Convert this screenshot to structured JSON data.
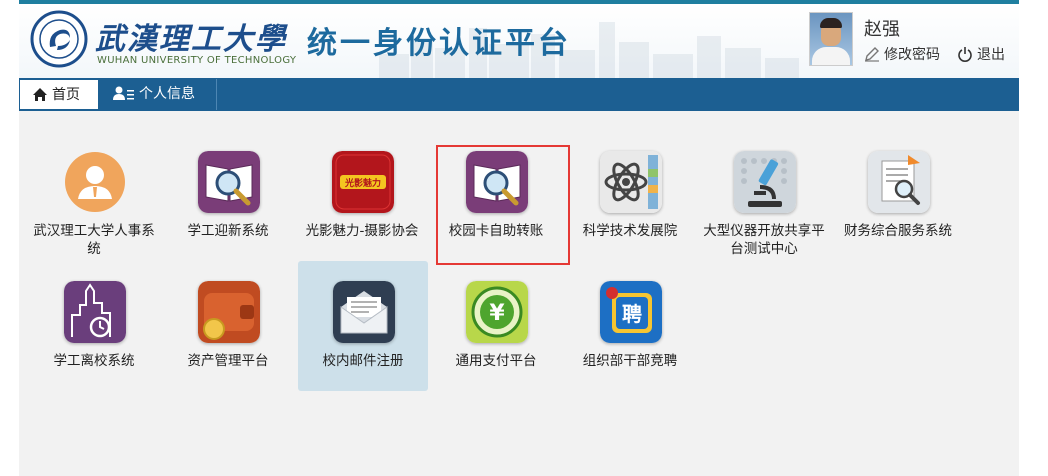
{
  "header": {
    "school_cn": "武漢理工大學",
    "school_en": "WUHAN UNIVERSITY OF TECHNOLOGY",
    "platform_title": "统一身份认证平台",
    "username": "赵强",
    "edit_password": "修改密码",
    "logout": "退出"
  },
  "nav": {
    "home": "首页",
    "profile": "个人信息"
  },
  "apps": [
    {
      "label": "武汉理工大学人事系统",
      "icon": "person-icon"
    },
    {
      "label": "学工迎新系统",
      "icon": "book-magnifier-icon"
    },
    {
      "label": "光影魅力-摄影协会",
      "icon": "photo-club-icon"
    },
    {
      "label": "校园卡自助转账",
      "icon": "book-magnifier-icon"
    },
    {
      "label": "科学技术发展院",
      "icon": "atom-icon"
    },
    {
      "label": "大型仪器开放共享平台测试中心",
      "icon": "microscope-icon"
    },
    {
      "label": "财务综合服务系统",
      "icon": "document-search-icon"
    },
    {
      "label": "学工离校系统",
      "icon": "city-clock-icon"
    },
    {
      "label": "资产管理平台",
      "icon": "wallet-icon"
    },
    {
      "label": "校内邮件注册",
      "icon": "mail-icon"
    },
    {
      "label": "通用支付平台",
      "icon": "yuan-icon"
    },
    {
      "label": "组织部干部竞聘",
      "icon": "recruit-icon"
    }
  ],
  "photo_club_badge": "光影魅力",
  "recruit_badge": "聘",
  "colors": {
    "accent": "#1c5f92",
    "highlight": "#e53935",
    "selected_bg": "#cde0ea"
  }
}
